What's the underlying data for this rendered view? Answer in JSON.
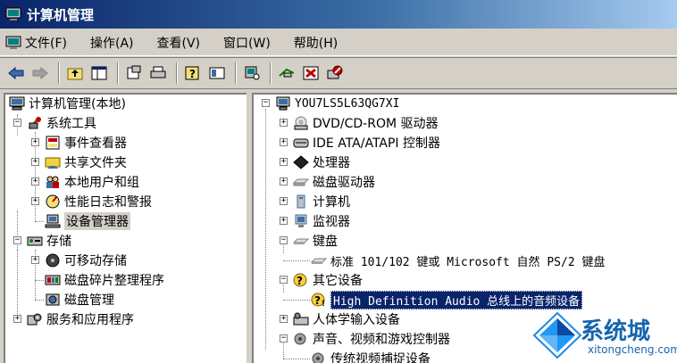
{
  "window": {
    "title": "计算机管理"
  },
  "menu": [
    "文件(F)",
    "操作(A)",
    "查看(V)",
    "窗口(W)",
    "帮助(H)"
  ],
  "left_tree": {
    "root": "计算机管理(本地)",
    "system_tools": "系统工具",
    "system_tools_children": [
      "事件查看器",
      "共享文件夹",
      "本地用户和组",
      "性能日志和警报",
      "设备管理器"
    ],
    "storage": "存储",
    "storage_children": [
      "可移动存储",
      "磁盘碎片整理程序",
      "磁盘管理"
    ],
    "services": "服务和应用程序"
  },
  "right_tree": {
    "computer": "YOU7LS5L63QG7XI",
    "categories": [
      "DVD/CD-ROM 驱动器",
      "IDE ATA/ATAPI 控制器",
      "处理器",
      "磁盘驱动器",
      "计算机",
      "监视器",
      "键盘"
    ],
    "keyboard_device": "标准 101/102 键或 Microsoft 自然 PS/2 键盘",
    "other_devices": "其它设备",
    "selected_device": "High Definition Audio 总线上的音频设备",
    "hid": "人体学输入设备",
    "sound": "声音、视频和游戏控制器",
    "sound_child": "传统视频捕捉设备"
  },
  "watermark": {
    "text": "系统城",
    "url": "xitongcheng.com"
  }
}
